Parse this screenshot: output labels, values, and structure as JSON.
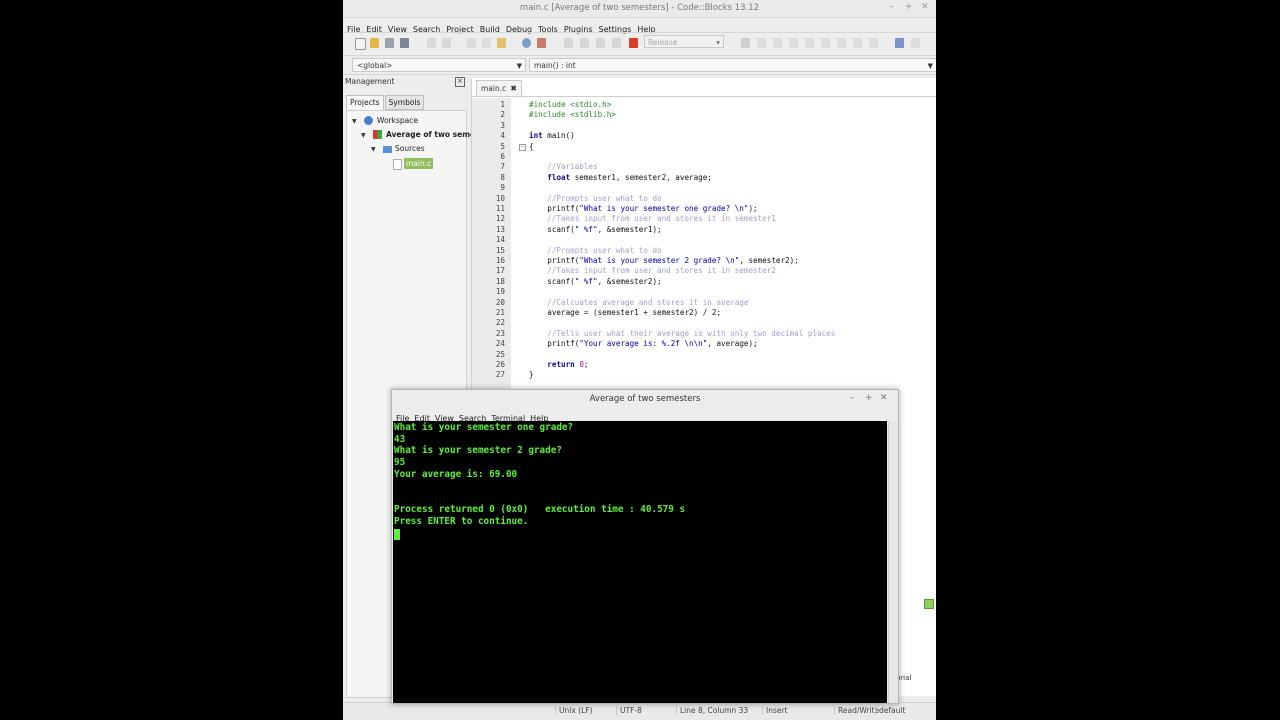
{
  "ide": {
    "window_title": "main.c [Average of two semesters] - Code::Blocks 13.12",
    "menu": [
      "File",
      "Edit",
      "View",
      "Search",
      "Project",
      "Build",
      "Debug",
      "Tools",
      "Plugins",
      "Settings",
      "Help"
    ],
    "build_target": "Release",
    "scope_combo": "<global>",
    "function_combo": "main() : int",
    "management": {
      "title": "Management",
      "tabs": [
        "Projects",
        "Symbols"
      ],
      "tree": {
        "workspace": "Workspace",
        "project": "Average of two semes",
        "folder": "Sources",
        "file": "main.c"
      }
    },
    "editor_tab": "main.c",
    "code": [
      {
        "n": "1",
        "t": "#include <stdio.h>",
        "c": "pp"
      },
      {
        "n": "2",
        "t": "#include <stdlib.h>",
        "c": "pp"
      },
      {
        "n": "3",
        "t": "",
        "c": ""
      },
      {
        "n": "4",
        "t": "int main()",
        "c": "fn"
      },
      {
        "n": "5",
        "t": "{",
        "c": ""
      },
      {
        "n": "6",
        "t": "",
        "c": ""
      },
      {
        "n": "7",
        "t": "    //Variables",
        "c": "cm"
      },
      {
        "n": "8",
        "t": "    float semester1, semester2, average;",
        "c": "decl"
      },
      {
        "n": "9",
        "t": "",
        "c": ""
      },
      {
        "n": "10",
        "t": "    //Prompts user what to do",
        "c": "cm"
      },
      {
        "n": "11",
        "t": "    printf(\"What is your semester one grade? \\n\");",
        "c": "call"
      },
      {
        "n": "12",
        "t": "    //Takes input from user and stores it in semester1",
        "c": "cm"
      },
      {
        "n": "13",
        "t": "    scanf(\" %f\", &semester1);",
        "c": "call"
      },
      {
        "n": "14",
        "t": "",
        "c": ""
      },
      {
        "n": "15",
        "t": "    //Prompts user what to do",
        "c": "cm"
      },
      {
        "n": "16",
        "t": "    printf(\"What is your semester 2 grade? \\n\", semester2);",
        "c": "call"
      },
      {
        "n": "17",
        "t": "    //Takes input from user and stores it in semester2",
        "c": "cm"
      },
      {
        "n": "18",
        "t": "    scanf(\" %f\", &semester2);",
        "c": "call"
      },
      {
        "n": "19",
        "t": "",
        "c": ""
      },
      {
        "n": "20",
        "t": "    //Calcuates average and stores it in average",
        "c": "cm"
      },
      {
        "n": "21",
        "t": "    average = (semester1 + semester2) / 2;",
        "c": "plain"
      },
      {
        "n": "22",
        "t": "",
        "c": ""
      },
      {
        "n": "23",
        "t": "    //Tells user what their average is with only two decimal places",
        "c": "cm"
      },
      {
        "n": "24",
        "t": "    printf(\"Your average is: %.2f \\n\\n\", average);",
        "c": "call"
      },
      {
        "n": "25",
        "t": "",
        "c": ""
      },
      {
        "n": "26",
        "t": "    return 0;",
        "c": "ret"
      },
      {
        "n": "27",
        "t": "}",
        "c": ""
      }
    ],
    "bottom_panel_tail": "orial",
    "status": {
      "eol": "Unix (LF)",
      "encoding": "UTF-8",
      "position": "Line 8, Column 33",
      "mode": "Insert",
      "access": "Read/Write",
      "lang": "default"
    }
  },
  "terminal": {
    "title": "Average of two semesters",
    "menu": [
      "File",
      "Edit",
      "View",
      "Search",
      "Terminal",
      "Help"
    ],
    "lines": [
      "What is your semester one grade?",
      "43",
      "What is your semester 2 grade?",
      "95",
      "Your average is: 69.00",
      "",
      "",
      "Process returned 0 (0x0)   execution time : 40.579 s",
      "Press ENTER to continue."
    ],
    "colors": {
      "text": "#5ef03a",
      "background": "#000000"
    }
  }
}
